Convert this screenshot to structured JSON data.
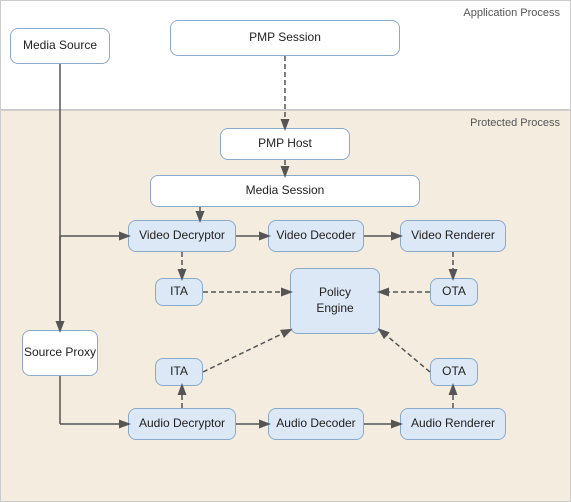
{
  "regions": {
    "app_process_label": "Application Process",
    "protected_process_label": "Protected Process"
  },
  "boxes": {
    "media_source": "Media Source",
    "pmp_session": "PMP Session",
    "pmp_host": "PMP Host",
    "media_session": "Media Session",
    "video_decryptor": "Video Decryptor",
    "video_decoder": "Video Decoder",
    "video_renderer": "Video Renderer",
    "ita_top": "ITA",
    "ota_top": "OTA",
    "policy_engine": "Policy\nEngine",
    "ita_bottom": "ITA",
    "ota_bottom": "OTA",
    "audio_decryptor": "Audio Decryptor",
    "audio_decoder": "Audio Decoder",
    "audio_renderer": "Audio Renderer",
    "source_proxy": "Source\nProxy"
  }
}
